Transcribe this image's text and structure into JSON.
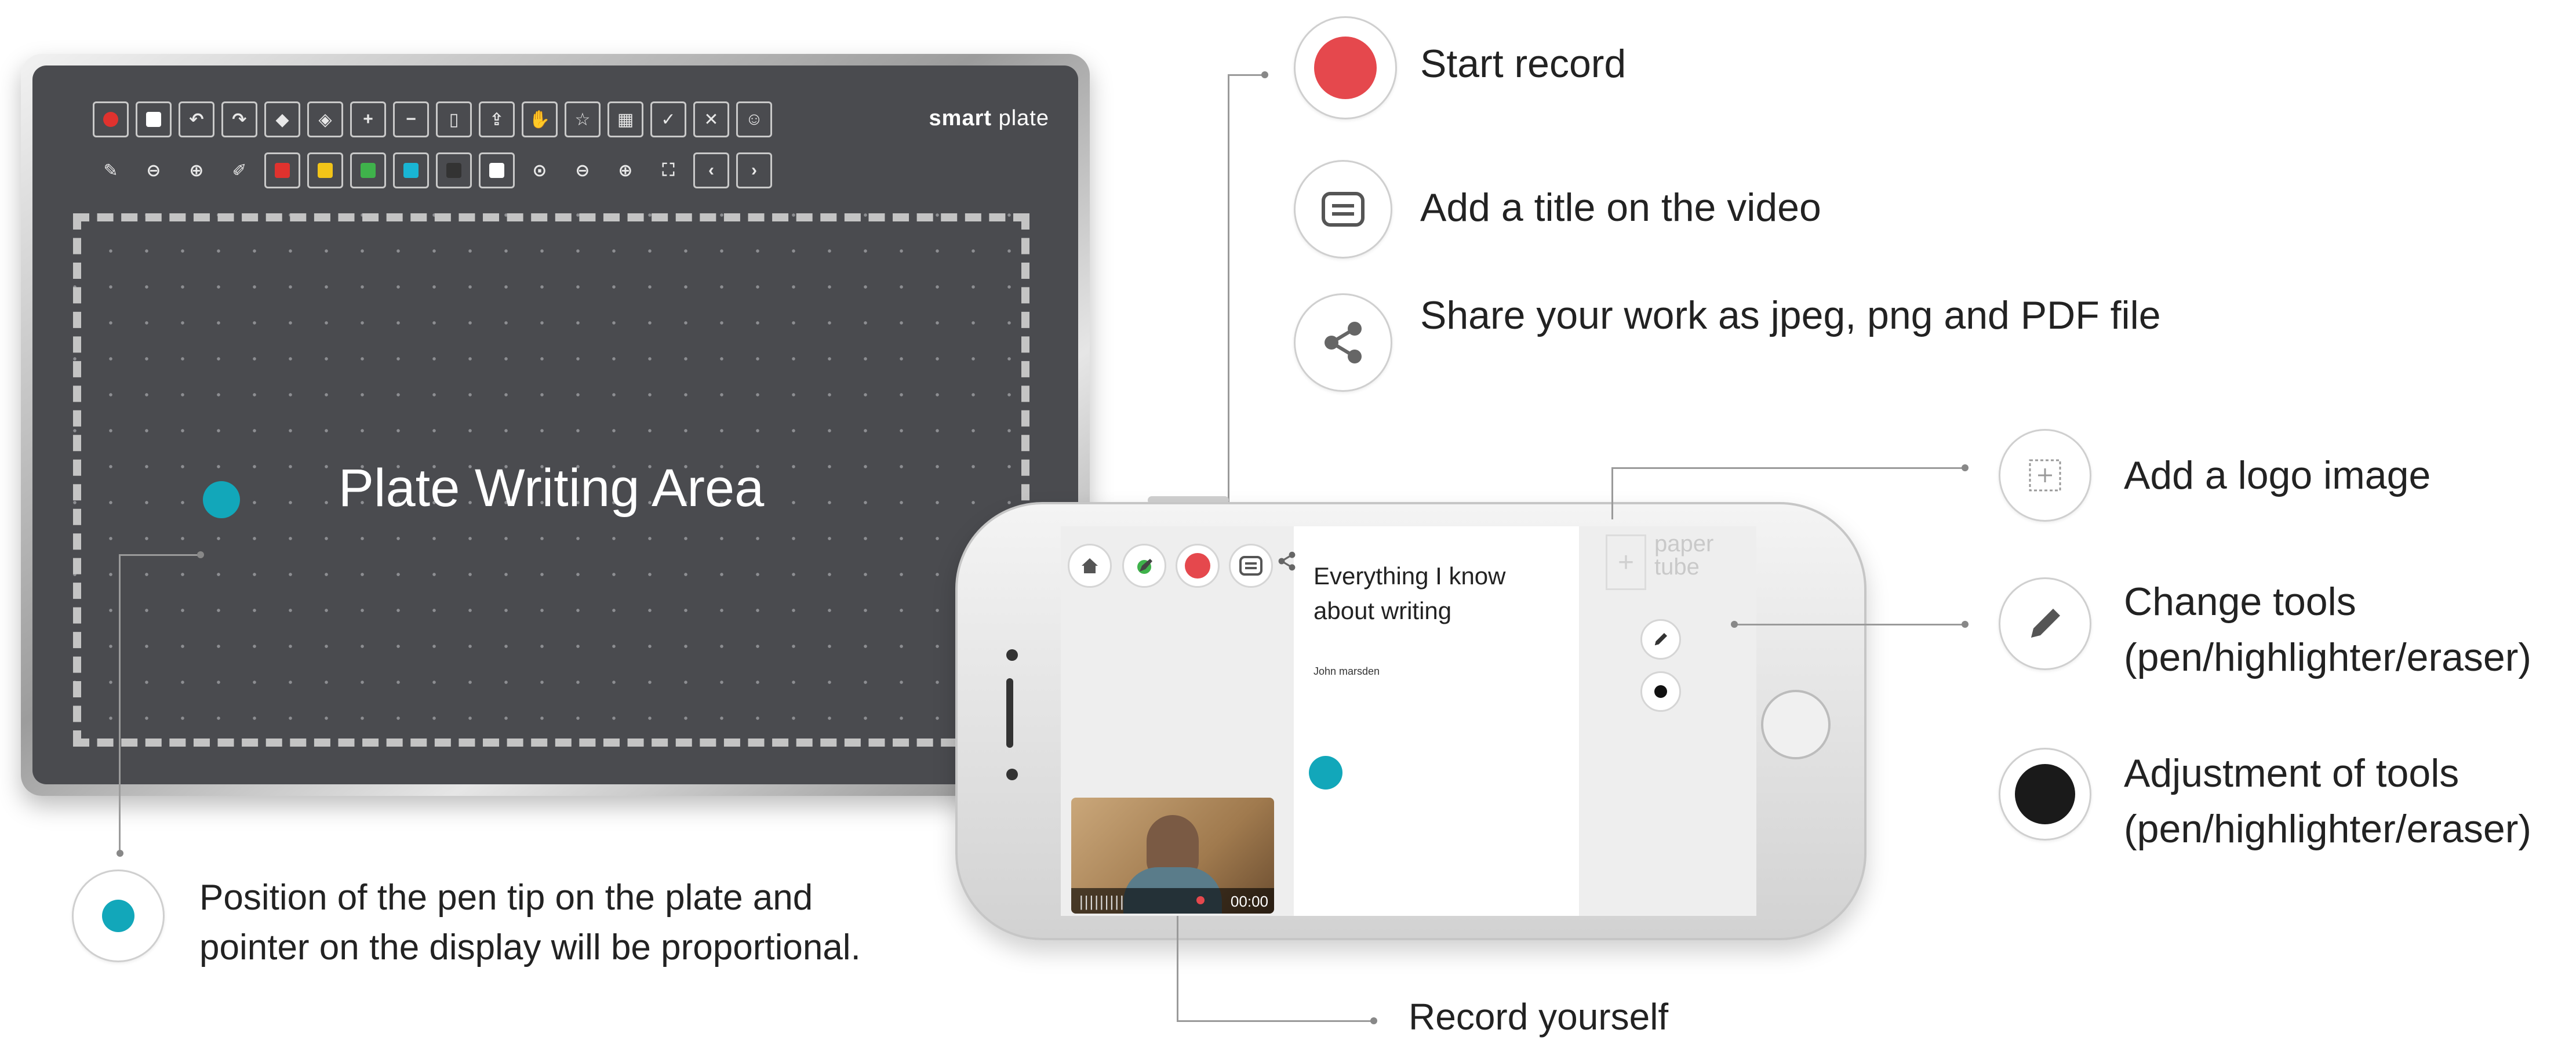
{
  "plate": {
    "brand_bold": "smart",
    "brand_rest": " plate",
    "area_label": "Plate Writing Area",
    "toolbar_row1": [
      {
        "icon": "record-icon"
      },
      {
        "icon": "stop-icon"
      },
      {
        "icon": "undo-icon"
      },
      {
        "icon": "redo-icon"
      },
      {
        "icon": "eraser-icon"
      },
      {
        "icon": "clear-icon"
      },
      {
        "icon": "add-page-icon",
        "glyph": "+"
      },
      {
        "icon": "remove-page-icon",
        "glyph": "−"
      },
      {
        "icon": "page-icon"
      },
      {
        "icon": "export-icon"
      },
      {
        "icon": "hand-icon"
      },
      {
        "icon": "star-icon"
      },
      {
        "icon": "calendar-icon"
      },
      {
        "icon": "check-icon",
        "glyph": "✓"
      },
      {
        "icon": "close-icon",
        "glyph": "✕"
      },
      {
        "icon": "smiley-icon"
      }
    ],
    "toolbar_row2_colors": [
      "#e0322e",
      "#f2c418",
      "#3fb24b",
      "#19b5d4",
      "#333333",
      "#ffffff"
    ]
  },
  "phone": {
    "doc_title": "Everything I know about writing",
    "doc_author": "John marsden",
    "video_time": "00:00",
    "brand_line1": "paper",
    "brand_line2": "tube"
  },
  "legend": {
    "start_record": "Start record",
    "add_title": "Add a title on the video",
    "share": "Share your work as jpeg, png and PDF file",
    "add_logo": "Add a logo image",
    "change_tools_1": "Change tools",
    "change_tools_2": "(pen/highlighter/eraser)",
    "adjust_tools_1": "Adjustment of tools",
    "adjust_tools_2": "(pen/highlighter/eraser)",
    "pen_tip_1": "Position of the pen tip on the plate and",
    "pen_tip_2": "pointer on the display will be proportional.",
    "record_yourself": "Record yourself"
  },
  "colors": {
    "accent_teal": "#12a7ba",
    "record_red": "#e5484d",
    "plate_face": "#4a4b4f"
  }
}
